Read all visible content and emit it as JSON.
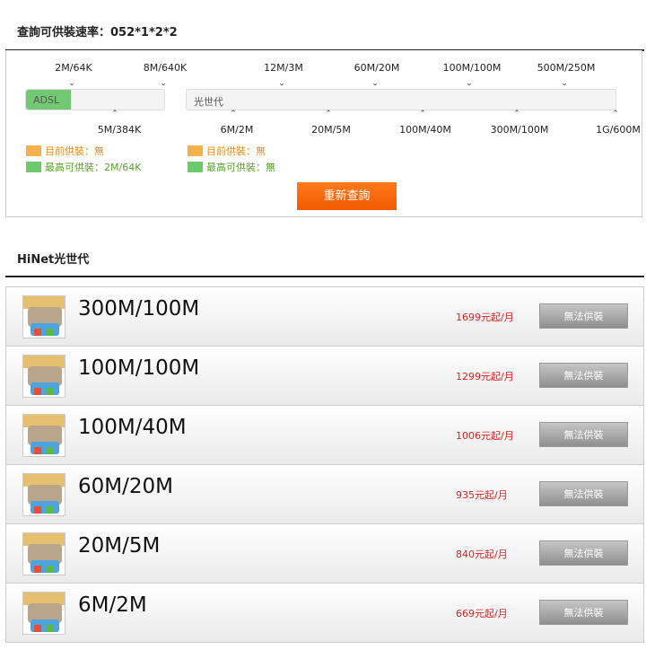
{
  "header": {
    "title": "查詢可供裝速率：052*1*2*2"
  },
  "speed_selector": {
    "top_ticks": [
      "2M/64K",
      "8M/640K",
      "12M/3M",
      "60M/20M",
      "100M/100M",
      "500M/250M"
    ],
    "bottom_ticks": [
      "5M/384K",
      "6M/2M",
      "20M/5M",
      "100M/40M",
      "300M/100M",
      "1G/600M"
    ],
    "adsl_bar": {
      "label": "ADSL"
    },
    "fiber_bar": {
      "label": "光世代"
    },
    "legend_adsl": {
      "current": "目前供裝：無",
      "max": "最高可供裝：2M/64K"
    },
    "legend_fiber": {
      "current": "目前供裝：無",
      "max": "最高可供裝：無"
    },
    "requery_button": "重新查詢"
  },
  "plans_section": {
    "title": "HiNet光世代"
  },
  "plans": [
    {
      "name": "300M/100M",
      "price": "1699元起/月",
      "button": "無法供裝"
    },
    {
      "name": "100M/100M",
      "price": "1299元起/月",
      "button": "無法供裝"
    },
    {
      "name": "100M/40M",
      "price": "1006元起/月",
      "button": "無法供裝"
    },
    {
      "name": "60M/20M",
      "price": "935元起/月",
      "button": "無法供裝"
    },
    {
      "name": "20M/5M",
      "price": "840元起/月",
      "button": "無法供裝"
    },
    {
      "name": "6M/2M",
      "price": "669元起/月",
      "button": "無法供裝"
    }
  ],
  "colors": {
    "accent": "#f25a00",
    "price": "#e02020",
    "adsl_fill": "#73c973",
    "legend_orange": "#f4b04a",
    "legend_green": "#6cc96c"
  }
}
